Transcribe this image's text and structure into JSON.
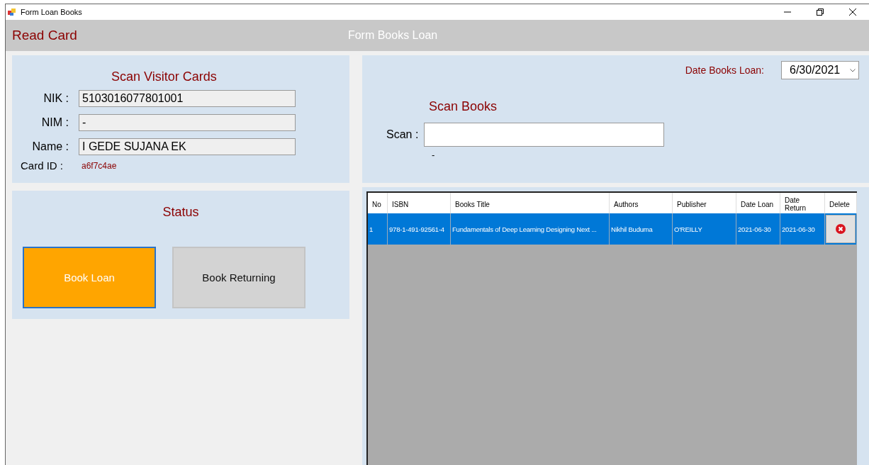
{
  "window": {
    "title": "Form Loan Books"
  },
  "header": {
    "left_title": "Read Card",
    "center_title": "Form Books Loan"
  },
  "visitor_card": {
    "title": "Scan Visitor Cards",
    "fields": [
      {
        "label": "NIK :",
        "value": "5103016077801001"
      },
      {
        "label": "NIM :",
        "value": "-"
      },
      {
        "label": "Name :",
        "value": "I GEDE SUJANA EK"
      }
    ],
    "card_id_label": "Card ID :",
    "card_id": "a6f7c4ae"
  },
  "status": {
    "title": "Status",
    "buttons": [
      {
        "label": "Book Loan",
        "selected": true
      },
      {
        "label": "Book Returning",
        "selected": false
      }
    ]
  },
  "scan_books": {
    "date_label": "Date Books Loan:",
    "date_value": "6/30/2021",
    "title": "Scan Books",
    "scan_label": "Scan :",
    "scan_result": "-"
  },
  "table": {
    "columns": [
      "No",
      "ISBN",
      "Books Title",
      "Authors",
      "Publisher",
      "Date Loan",
      "Date Return",
      "Delete"
    ],
    "rows": [
      {
        "cells": [
          "1",
          "978-1-491-92561-4",
          "Fundamentals of Deep Learning Designing Next ...",
          "Nikhil Buduma",
          "O'REILLY",
          "2021-06-30",
          "2021-06-30"
        ],
        "selected": true
      }
    ]
  }
}
